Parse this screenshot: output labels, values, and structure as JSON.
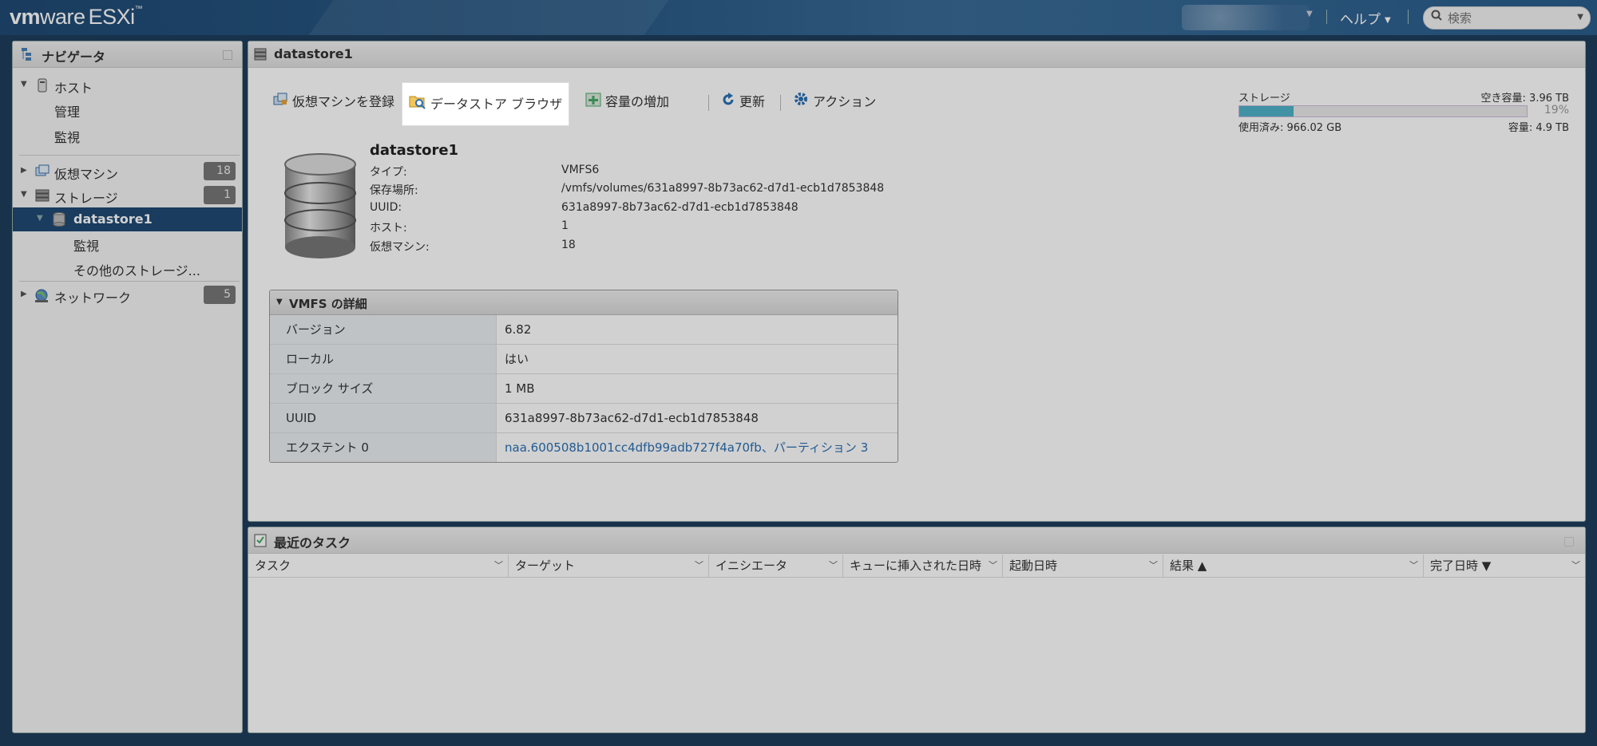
{
  "topbar": {
    "logo_vm": "vm",
    "logo_ware": "ware",
    "logo_product": "ESXi",
    "logo_tm": "™",
    "help_label": "ヘルプ",
    "search_placeholder": "検索"
  },
  "navigator": {
    "title": "ナビゲータ",
    "items": [
      {
        "label": "ホスト"
      },
      {
        "label": "管理"
      },
      {
        "label": "監視"
      },
      {
        "label": "仮想マシン",
        "badge": "18"
      },
      {
        "label": "ストレージ",
        "badge": "1"
      },
      {
        "label": "datastore1"
      },
      {
        "label": "監視"
      },
      {
        "label": "その他のストレージ..."
      },
      {
        "label": "ネットワーク",
        "badge": "5"
      }
    ]
  },
  "main": {
    "title": "datastore1",
    "toolbar": {
      "register_vm": "仮想マシンを登録",
      "datastore_browser": "データストア ブラウザ",
      "increase_capacity": "容量の増加",
      "refresh": "更新",
      "actions": "アクション"
    },
    "storage": {
      "label": "ストレージ",
      "free": "空き容量: 3.96 TB",
      "percent": "19%",
      "used_fraction": 0.19,
      "used": "使用済み: 966.02 GB",
      "capacity": "容量: 4.9 TB"
    },
    "datastore": {
      "name": "datastore1",
      "rows": [
        {
          "k": "タイプ:",
          "v": "VMFS6"
        },
        {
          "k": "保存場所:",
          "v": "/vmfs/volumes/631a8997-8b73ac62-d7d1-ecb1d7853848"
        },
        {
          "k": "UUID:",
          "v": "631a8997-8b73ac62-d7d1-ecb1d7853848"
        },
        {
          "k": "ホスト:",
          "v": "1"
        },
        {
          "k": "仮想マシン:",
          "v": "18"
        }
      ]
    },
    "vmfs": {
      "title": "VMFS の詳細",
      "rows": [
        {
          "k": "バージョン",
          "v": "6.82"
        },
        {
          "k": "ローカル",
          "v": "はい"
        },
        {
          "k": "ブロック サイズ",
          "v": "1 MB"
        },
        {
          "k": "UUID",
          "v": "631a8997-8b73ac62-d7d1-ecb1d7853848"
        },
        {
          "k": "エクステント 0",
          "v": "naa.600508b1001cc4dfb99adb727f4a70fb、パーティション 3"
        }
      ]
    }
  },
  "tasks": {
    "title": "最近のタスク",
    "columns": [
      "タスク",
      "ターゲット",
      "イニシエータ",
      "キューに挿入された日時",
      "起動日時",
      "結果 ▲",
      "完了日時 ▼"
    ]
  },
  "colors": {
    "topbar": "#2a5b87",
    "selected_nav": "#1f4a74",
    "meter_fill": "#4fb2c9",
    "link": "#2a6fb4"
  }
}
